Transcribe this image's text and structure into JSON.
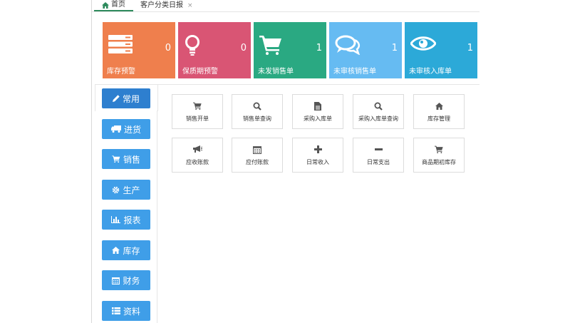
{
  "tabs": {
    "home": "首页",
    "report": "客户分类日报",
    "close": "×"
  },
  "tiles": [
    {
      "label": "库存预警",
      "count": "0",
      "color": "#ef7f4d",
      "icon": "server-icon"
    },
    {
      "label": "保质期预警",
      "count": "0",
      "color": "#d95574",
      "icon": "lightbulb-icon"
    },
    {
      "label": "未发销售单",
      "count": "1",
      "color": "#2aa982",
      "icon": "cart-icon"
    },
    {
      "label": "未审核销售单",
      "count": "1",
      "color": "#66bbf2",
      "icon": "comments-icon"
    },
    {
      "label": "未审核入库单",
      "count": "1",
      "color": "#2ca9d8",
      "icon": "eye-icon"
    }
  ],
  "sidebar": {
    "items": [
      {
        "label": "常用",
        "icon": "pencil-icon"
      },
      {
        "label": "进货",
        "icon": "truck-icon"
      },
      {
        "label": "销售",
        "icon": "cart-icon"
      },
      {
        "label": "生产",
        "icon": "gear-icon"
      },
      {
        "label": "报表",
        "icon": "bar-chart-icon"
      },
      {
        "label": "库存",
        "icon": "home-icon"
      },
      {
        "label": "财务",
        "icon": "calendar-icon"
      },
      {
        "label": "资料",
        "icon": "list-icon"
      }
    ]
  },
  "shortcuts": [
    {
      "label": "销售开单",
      "icon": "cart-icon"
    },
    {
      "label": "销售单查询",
      "icon": "search-icon"
    },
    {
      "label": "采购入库单",
      "icon": "file-icon"
    },
    {
      "label": "采购入库单查询",
      "icon": "search-icon"
    },
    {
      "label": "库存管理",
      "icon": "home-icon"
    },
    {
      "label": "应收账款",
      "icon": "bullhorn-icon"
    },
    {
      "label": "应付账款",
      "icon": "calendar-icon"
    },
    {
      "label": "日常收入",
      "icon": "plus-icon"
    },
    {
      "label": "日常支出",
      "icon": "minus-icon"
    },
    {
      "label": "商品期初库存",
      "icon": "cart-icon"
    }
  ]
}
